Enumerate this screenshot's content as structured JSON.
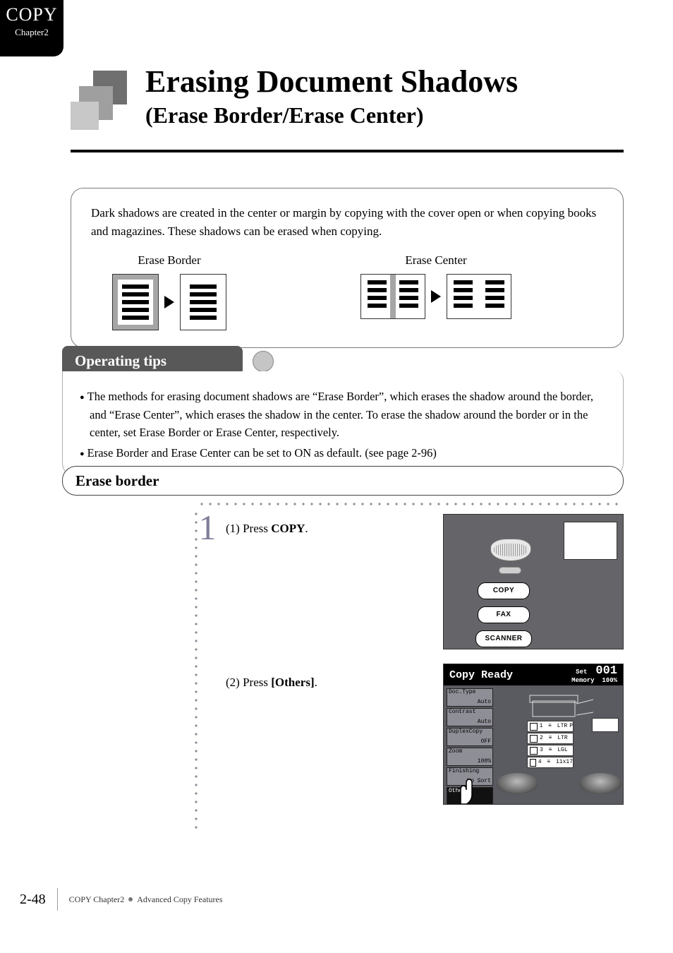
{
  "chapter_tab": {
    "line1": "COPY",
    "line2": "Chapter2"
  },
  "heading": {
    "title": "Erasing Document Shadows",
    "subtitle": "(Erase Border/Erase Center)"
  },
  "intro": {
    "paragraph": "Dark shadows are created in the center or margin by copying with the cover open or when copying books and magazines. These shadows can be erased when copying.",
    "diagram_left_title": "Erase Border",
    "diagram_right_title": "Erase Center"
  },
  "operating_tips": {
    "heading": "Operating tips",
    "bullets": [
      "The methods for erasing document shadows are “Erase Border”, which erases the shadow around the border, and “Erase Center”, which erases the shadow in the center. To erase the shadow around the border or in the center, set Erase Border or Erase Center, respectively.",
      "Erase Border and Erase Center can be set to ON as default. (see page 2-96)"
    ]
  },
  "section": {
    "title": "Erase border"
  },
  "steps": {
    "num1": "1",
    "s1_prefix": "(1)",
    "s1_verb": "Press ",
    "s1_key": "COPY",
    "s1_suffix": ".",
    "s2_prefix": "(2)",
    "s2_verb": "Press ",
    "s2_key": "[Others]",
    "s2_suffix": "."
  },
  "panel": {
    "keys": {
      "copy": "COPY",
      "fax": "FAX",
      "scanner": "SCANNER"
    }
  },
  "touch": {
    "title": "Copy Ready",
    "set_label": "Set",
    "set_value": "001",
    "memory_label": "Memory",
    "memory_value": "100%",
    "softkeys": [
      {
        "label": "Doc.Type",
        "value": "Auto"
      },
      {
        "label": "Contrast",
        "value": "Auto"
      },
      {
        "label": "DuplexCopy",
        "value": "OFF"
      },
      {
        "label": "Zoom",
        "value": "100%"
      },
      {
        "label": "Finishing",
        "value": "No Sort"
      },
      {
        "label": "Others",
        "value": ""
      }
    ],
    "trays": [
      {
        "num": "1",
        "size": "LTR",
        "orient": "P"
      },
      {
        "num": "2",
        "size": "LTR",
        "orient": ""
      },
      {
        "num": "3",
        "size": "LGL",
        "orient": ""
      },
      {
        "num": "4",
        "size": "11x17",
        "orient": ""
      }
    ]
  },
  "footer": {
    "page": "2-48",
    "crumb1": "COPY Chapter2",
    "crumb2": "Advanced Copy Features"
  }
}
